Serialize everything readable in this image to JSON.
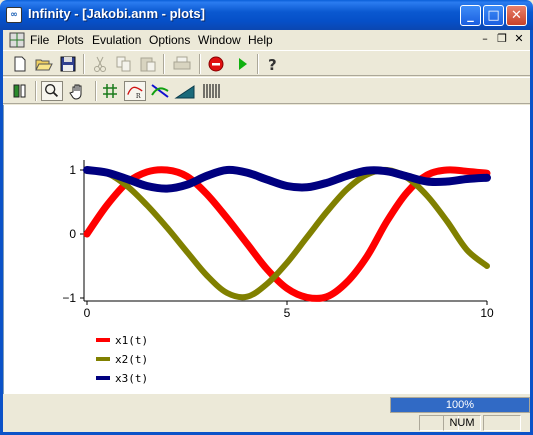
{
  "window": {
    "title": "Infinity - [Jakobi.anm - plots]",
    "app_icon_text": "∞",
    "minimize": "_",
    "maximize": "□",
    "close": "✕"
  },
  "menu": {
    "items": [
      "File",
      "Plots",
      "Evulation",
      "Options",
      "Window",
      "Help"
    ],
    "mdi_minimize": "–",
    "mdi_restore": "❐",
    "mdi_close": "✕"
  },
  "toolbar1": {
    "icons": [
      "new-icon",
      "open-icon",
      "save-icon",
      "cut-icon",
      "copy-icon",
      "paste-icon",
      "print-icon",
      "stop-icon",
      "run-icon",
      "help-icon"
    ]
  },
  "toolbar2": {
    "icons": [
      "pencil-icon",
      "zoom-icon",
      "hand-pan-icon",
      "grid-icon",
      "curve-fit-icon",
      "crossing-icon",
      "area-icon",
      "pattern-icon"
    ]
  },
  "chart_data": {
    "type": "line",
    "xlim": [
      0,
      10
    ],
    "ylim": [
      -1,
      1
    ],
    "xticks": [
      "0",
      "5",
      "10"
    ],
    "yticks": [
      "1",
      "0",
      "−1"
    ],
    "legend_position": "bottom-left",
    "grid": false,
    "series": [
      {
        "name": "x1(t)",
        "color": "#ff0000",
        "x": [
          0,
          0.5,
          1,
          1.5,
          2,
          2.5,
          3,
          3.5,
          4,
          4.5,
          5,
          5.5,
          6,
          6.5,
          7,
          7.5,
          8,
          8.5,
          9,
          9.5,
          10
        ],
        "y": [
          0,
          0.45,
          0.8,
          0.97,
          1.0,
          0.9,
          0.62,
          0.25,
          -0.15,
          -0.55,
          -0.85,
          -0.99,
          -0.98,
          -0.75,
          -0.35,
          0.2,
          0.65,
          0.92,
          1.0,
          0.98,
          0.95
        ]
      },
      {
        "name": "x2(t)",
        "color": "#808000",
        "x": [
          0,
          0.5,
          1,
          1.5,
          2,
          2.5,
          3,
          3.5,
          4,
          4.5,
          5,
          5.5,
          6,
          6.5,
          7,
          7.5,
          8,
          8.5,
          9,
          9.5,
          10
        ],
        "y": [
          1,
          0.95,
          0.75,
          0.45,
          0.1,
          -0.28,
          -0.65,
          -0.92,
          -0.98,
          -0.78,
          -0.45,
          -0.05,
          0.35,
          0.7,
          0.93,
          1.0,
          0.88,
          0.6,
          0.2,
          -0.25,
          -0.5
        ]
      },
      {
        "name": "x3(t)",
        "color": "#00007f",
        "x": [
          0,
          0.5,
          1,
          1.5,
          2,
          2.5,
          3,
          3.5,
          4,
          4.5,
          5,
          5.5,
          6,
          6.5,
          7,
          7.5,
          8,
          8.5,
          9,
          9.5,
          10
        ],
        "y": [
          1,
          0.96,
          0.86,
          0.75,
          0.71,
          0.77,
          0.91,
          1.0,
          0.96,
          0.85,
          0.75,
          0.73,
          0.8,
          0.91,
          0.99,
          0.98,
          0.9,
          0.82,
          0.82,
          0.86,
          0.88
        ]
      }
    ]
  },
  "status": {
    "progress_text": "100%",
    "progress_fraction": 1.0,
    "num": "NUM"
  }
}
